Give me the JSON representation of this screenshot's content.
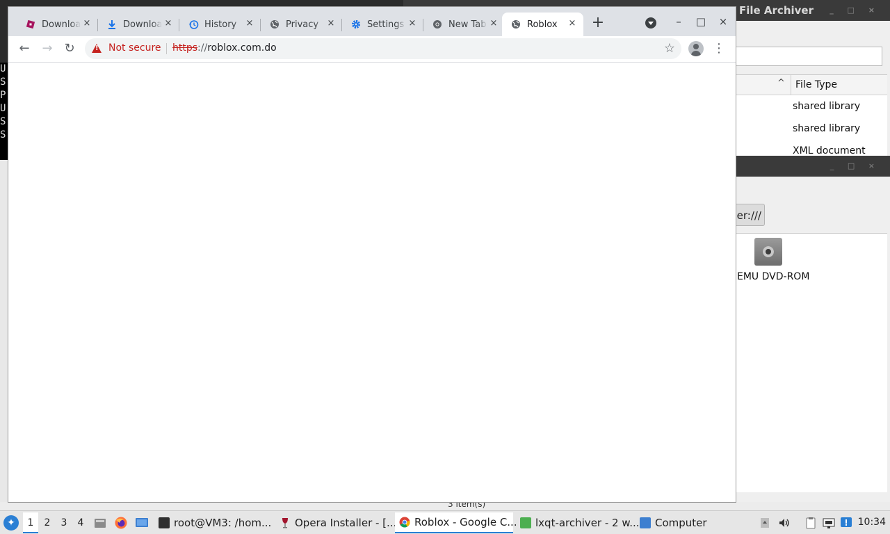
{
  "browser": {
    "tabs": [
      {
        "label": "Downloads",
        "icon": "roblox-icon",
        "active": false
      },
      {
        "label": "Downloads",
        "icon": "download-icon",
        "active": false
      },
      {
        "label": "History",
        "icon": "history-icon",
        "active": false
      },
      {
        "label": "Privacy",
        "icon": "globe-icon",
        "active": false
      },
      {
        "label": "Settings",
        "icon": "gear-icon",
        "active": false
      },
      {
        "label": "New Tab",
        "icon": "chrome-icon",
        "active": false
      },
      {
        "label": "Roblox",
        "icon": "globe-icon",
        "active": true
      }
    ],
    "new_tab_label": "+",
    "close_glyph": "×",
    "window_buttons": {
      "minimize": "–",
      "maximize": "□",
      "close": "×"
    },
    "nav": {
      "back": "←",
      "forward": "→",
      "reload": "↻",
      "menu": "⋮",
      "star": "☆"
    },
    "omnibox": {
      "security_label": "Not secure",
      "url_scheme": "https",
      "url_separator": "://",
      "url_host": "roblox.com.do"
    },
    "page_content": ""
  },
  "background": {
    "archiver": {
      "title": "File Archiver",
      "sort_indicator": "^",
      "column_header": "File Type",
      "rows": [
        "shared library",
        "shared library",
        "XML document"
      ]
    },
    "file_manager": {
      "path_fragment": "er:///",
      "device_label": "EMU DVD-ROM"
    },
    "terminal_letters": [
      "U",
      "S",
      "P",
      "U",
      "S",
      "S"
    ],
    "status_text": "3 item(s)"
  },
  "taskbar": {
    "workspaces": [
      "1",
      "2",
      "3",
      "4"
    ],
    "active_workspace": "1",
    "tasks": [
      {
        "label": "root@VM3: /hom...",
        "icon": "terminal-icon"
      },
      {
        "label": "Opera Installer - [...",
        "icon": "wine-icon"
      },
      {
        "label": "Roblox - Google C...",
        "icon": "chrome-icon",
        "active": true
      },
      {
        "label": "lxqt-archiver - 2 w...",
        "icon": "archiver-icon"
      },
      {
        "label": "Computer",
        "icon": "folder-icon"
      }
    ],
    "clock": "10:34"
  },
  "colors": {
    "danger": "#c5221f",
    "tabstrip": "#dee1e6",
    "accent": "#2a7fd4"
  }
}
